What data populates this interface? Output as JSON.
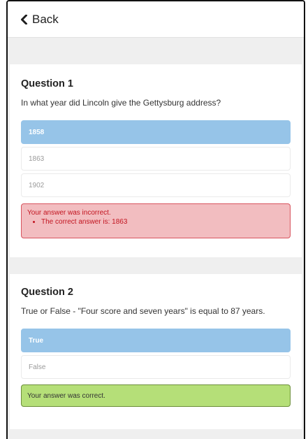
{
  "nav": {
    "back_label": "Back"
  },
  "questions": [
    {
      "title": "Question 1",
      "text": "In what year did Lincoln give the Gettysburg address?",
      "options": [
        {
          "label": "1858",
          "selected": true
        },
        {
          "label": "1863",
          "selected": false
        },
        {
          "label": "1902",
          "selected": false
        }
      ],
      "feedback": {
        "status": "incorrect",
        "message": "Your answer was incorrect.",
        "detail": "The correct answer is: 1863"
      }
    },
    {
      "title": "Question 2",
      "text": "True or False - \"Four score and seven years\" is equal to 87 years.",
      "options": [
        {
          "label": "True",
          "selected": true
        },
        {
          "label": "False",
          "selected": false
        }
      ],
      "feedback": {
        "status": "correct",
        "message": "Your answer was correct."
      }
    }
  ],
  "colors": {
    "selected_option": "#96c4e8",
    "incorrect_bg": "#f2bdc0",
    "incorrect_text": "#c2141f",
    "correct_bg": "#b5df78"
  }
}
